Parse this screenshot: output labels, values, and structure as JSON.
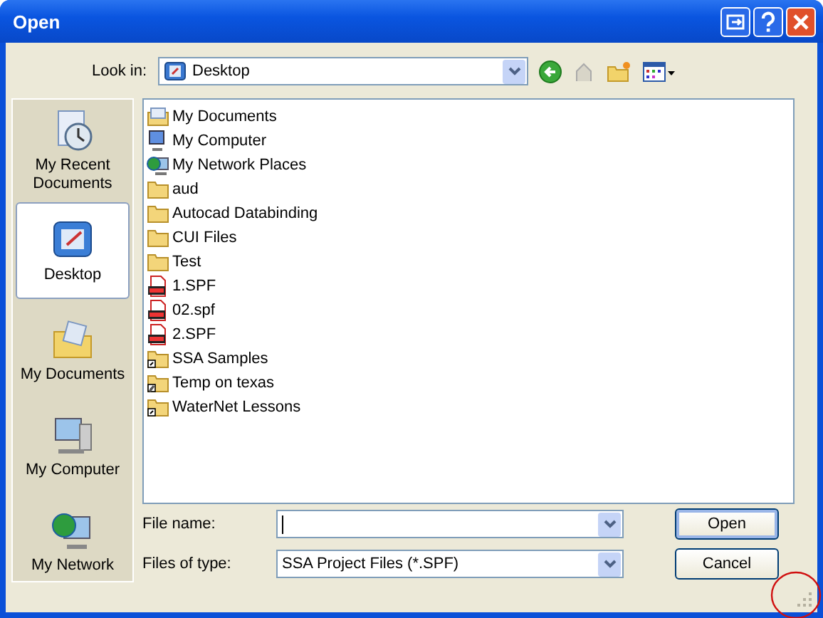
{
  "window": {
    "title": "Open"
  },
  "look_in": {
    "label": "Look in:",
    "value": "Desktop"
  },
  "places": [
    {
      "label": "My Recent Documents",
      "kind": "recent",
      "selected": false
    },
    {
      "label": "Desktop",
      "kind": "desktop",
      "selected": true
    },
    {
      "label": "My Documents",
      "kind": "documents",
      "selected": false
    },
    {
      "label": "My Computer",
      "kind": "computer",
      "selected": false
    },
    {
      "label": "My Network",
      "kind": "network",
      "selected": false
    }
  ],
  "files": [
    {
      "name": "My Documents",
      "kind": "documents"
    },
    {
      "name": "My Computer",
      "kind": "computer"
    },
    {
      "name": "My Network Places",
      "kind": "network"
    },
    {
      "name": "aud",
      "kind": "folder"
    },
    {
      "name": "Autocad Databinding",
      "kind": "folder"
    },
    {
      "name": "CUI Files",
      "kind": "folder"
    },
    {
      "name": "Test",
      "kind": "folder"
    },
    {
      "name": "1.SPF",
      "kind": "spf"
    },
    {
      "name": "02.spf",
      "kind": "spf"
    },
    {
      "name": "2.SPF",
      "kind": "spf"
    },
    {
      "name": "SSA Samples",
      "kind": "shortcut-folder"
    },
    {
      "name": "Temp on texas",
      "kind": "network-folder"
    },
    {
      "name": "WaterNet Lessons",
      "kind": "shortcut-folder"
    }
  ],
  "file_name": {
    "label": "File name:"
  },
  "file_type": {
    "label": "Files of type:",
    "value": "SSA Project Files (*.SPF)"
  },
  "buttons": [
    {
      "label": "Open",
      "kind": "default"
    },
    {
      "label": "Cancel",
      "kind": "normal"
    }
  ]
}
